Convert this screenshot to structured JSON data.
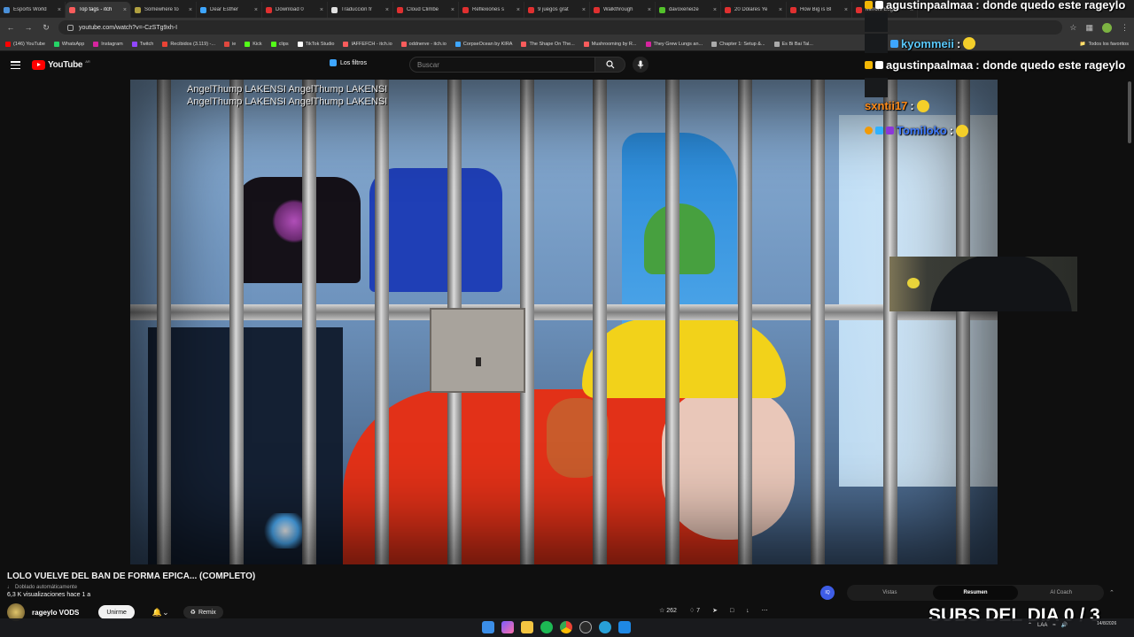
{
  "browser": {
    "tabs": [
      {
        "title": "Esports World",
        "color": "#4a90d9"
      },
      {
        "title": "Top tags - itch",
        "color": "#fa5c5c",
        "active": true
      },
      {
        "title": "Somewhere to",
        "color": "#b0a040"
      },
      {
        "title": "Dear Esther",
        "color": "#3ea6ff"
      },
      {
        "title": "Download 0",
        "color": "#e03030"
      },
      {
        "title": "Traducción fr",
        "color": "#e0e0e0"
      },
      {
        "title": "Cloud Climbe",
        "color": "#e03030"
      },
      {
        "title": "Reflexiones s",
        "color": "#e03030"
      },
      {
        "title": "9 juegos grat",
        "color": "#e03030"
      },
      {
        "title": "Walkthrough",
        "color": "#e03030"
      },
      {
        "title": "davoxeneize",
        "color": "#53c22b"
      },
      {
        "title": "20 Dólares Ye",
        "color": "#e03030"
      },
      {
        "title": "How Big is Bl",
        "color": "#e03030"
      },
      {
        "title": "Mirrors Edg",
        "color": "#e03030"
      }
    ],
    "url": "youtube.com/watch?v=-CzSTg9xh-I",
    "bookmarks": [
      {
        "label": "(146) YouTube",
        "color": "#ff0000"
      },
      {
        "label": "WhatsApp",
        "color": "#25d366"
      },
      {
        "label": "Instagram",
        "color": "#d6249f"
      },
      {
        "label": "Twitch",
        "color": "#9146ff"
      },
      {
        "label": "Recibidos (3.119) -...",
        "color": "#ea4335"
      },
      {
        "label": "ie",
        "color": "#e0483e"
      },
      {
        "label": "Kick",
        "color": "#53fc18"
      },
      {
        "label": "clips",
        "color": "#53fc18"
      },
      {
        "label": "TikTok Studio",
        "color": "#ffffff"
      },
      {
        "label": "IAFFEFCH - itch.io",
        "color": "#fa5c5c"
      },
      {
        "label": "oddnerve - itch.io",
        "color": "#fa5c5c"
      },
      {
        "label": "CorpseOcean by KIRA",
        "color": "#3ea6ff"
      },
      {
        "label": "The Shape On The...",
        "color": "#fa5c5c"
      },
      {
        "label": "Mushrooming by R...",
        "color": "#fa5c5c"
      },
      {
        "label": "They Grew Lungs an...",
        "color": "#d6249f"
      },
      {
        "label": "Chapter 1: Setup &...",
        "color": "#aaaaaa"
      },
      {
        "label": "Es Bi Bai Tal...",
        "color": "#aaaaaa"
      }
    ],
    "bookmarks_all": "Todos los favoritos"
  },
  "youtube": {
    "logo_text": "YouTube",
    "country": "AR",
    "filters_label": "Los filtros",
    "search_placeholder": "Buscar"
  },
  "video": {
    "overlay_line1": "AngelThump LAKENSI AngelThump LAKENSI",
    "overlay_line2": "AngelThump LAKENSI AngelThump LAKENSI",
    "title": "LOLO VUELVE DEL BAN DE FORMA EPICA... (COMPLETO)",
    "dubbed": "Doblado automáticamente",
    "views": "6,3 K visualizaciones  hace 1 a",
    "channel": "rageylo VODS",
    "subscribe_label": "Unirme",
    "remix_label": "Remix",
    "likes": "262",
    "comments": "7"
  },
  "chat": [
    {
      "user": "agustinpaalmaa",
      "message": ": donde quedo este rageylo",
      "user_color": "#ffffff",
      "msg_color": "#ffffff"
    },
    {
      "user": "kyommeii",
      "message": ":",
      "user_color": "#5ac8fa",
      "msg_color": "#ffffff"
    },
    {
      "user": "agustinpaalmaa",
      "message": ": donde quedo este rageylo",
      "user_color": "#ffffff",
      "msg_color": "#ffffff"
    },
    {
      "user": "sxntii17",
      "message": ":",
      "user_color": "#ff8c1a",
      "msg_color": "#ffffff"
    },
    {
      "user": "Tomiloko",
      "message": ":",
      "user_color": "#3f7bff",
      "msg_color": "#ffffff"
    }
  ],
  "summary": {
    "icon_label": "IQ",
    "tabs": [
      "Vistas",
      "Resumen",
      "AI Coach"
    ],
    "active_tab": "Resumen"
  },
  "subs_counter": "SUBS DEL DIA 0 / 3",
  "taskbar": {
    "lang": "LAA",
    "date": "14/8/2026"
  }
}
